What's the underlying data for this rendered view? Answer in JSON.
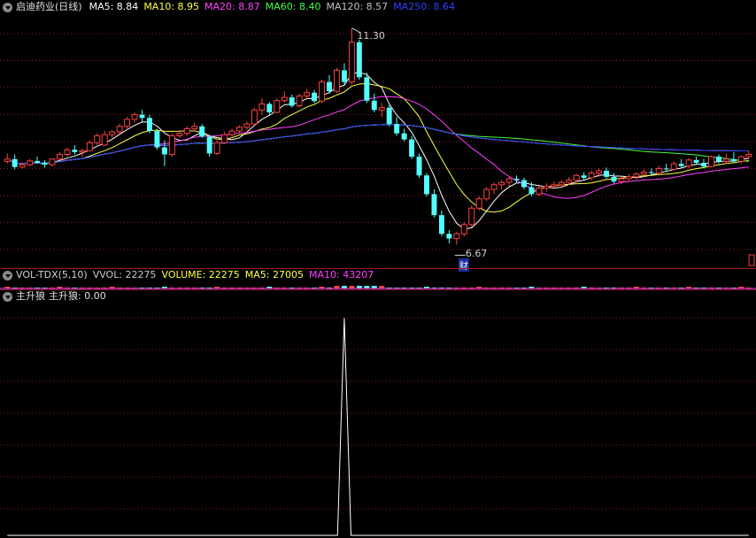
{
  "price_panel": {
    "stock_name": "启迪药业(日线)",
    "ma_legend": [
      {
        "text": "MA5: 8.84",
        "color": "#ffffff"
      },
      {
        "text": "MA10: 8.95",
        "color": "#ffff40"
      },
      {
        "text": "MA20: 8.87",
        "color": "#ff40ff"
      },
      {
        "text": "MA60: 8.40",
        "color": "#40ff40"
      },
      {
        "text": "MA120: 8.57",
        "color": "#c0c0c0"
      },
      {
        "text": "MA250: 8.64",
        "color": "#3040ff"
      }
    ],
    "high_label": "11.30",
    "low_label": "6.67",
    "event_marker": "财",
    "colors": {
      "up": "#ff4040",
      "down": "#54ffff",
      "grid": "#8b1e1e"
    }
  },
  "volume_panel": {
    "title": "VOL-TDX(5,10)",
    "items": [
      {
        "text": "VVOL: 22275",
        "color": "#c8c8c8"
      },
      {
        "text": "VOLUME: 22275",
        "color": "#ffff40"
      },
      {
        "text": "MA5: 27005",
        "color": "#ffff40"
      },
      {
        "text": "MA10: 43207",
        "color": "#ff40ff"
      }
    ]
  },
  "indicator_panel": {
    "title": "主升狼",
    "value_label": "主升狼: 0.00",
    "line_color": "#ffffff"
  },
  "chart_data": {
    "type": "candlestick",
    "candles_ohlc": [
      [
        8.45,
        8.62,
        8.4,
        8.5
      ],
      [
        8.5,
        8.6,
        8.28,
        8.33
      ],
      [
        8.33,
        8.42,
        8.3,
        8.38
      ],
      [
        8.38,
        8.5,
        8.35,
        8.46
      ],
      [
        8.46,
        8.55,
        8.4,
        8.42
      ],
      [
        8.42,
        8.48,
        8.32,
        8.38
      ],
      [
        8.38,
        8.52,
        8.35,
        8.5
      ],
      [
        8.5,
        8.65,
        8.48,
        8.6
      ],
      [
        8.6,
        8.75,
        8.55,
        8.7
      ],
      [
        8.7,
        8.8,
        8.6,
        8.65
      ],
      [
        8.65,
        8.72,
        8.55,
        8.68
      ],
      [
        8.68,
        8.9,
        8.66,
        8.85
      ],
      [
        8.85,
        9.05,
        8.8,
        9.0
      ],
      [
        8.8,
        9.1,
        8.78,
        9.02
      ],
      [
        9.02,
        9.12,
        8.95,
        9.08
      ],
      [
        9.08,
        9.25,
        9.04,
        9.2
      ],
      [
        9.2,
        9.4,
        9.15,
        9.35
      ],
      [
        9.35,
        9.5,
        9.28,
        9.45
      ],
      [
        9.45,
        9.55,
        9.3,
        9.38
      ],
      [
        9.38,
        9.45,
        9.05,
        9.1
      ],
      [
        9.1,
        9.15,
        8.7,
        8.75
      ],
      [
        8.75,
        8.9,
        8.35,
        8.6
      ],
      [
        8.6,
        9.05,
        8.55,
        9.0
      ],
      [
        9.0,
        9.12,
        8.95,
        9.05
      ],
      [
        9.05,
        9.2,
        9.0,
        9.15
      ],
      [
        9.15,
        9.28,
        9.1,
        9.2
      ],
      [
        9.2,
        9.25,
        8.95,
        8.98
      ],
      [
        8.98,
        9.02,
        8.55,
        8.62
      ],
      [
        8.62,
        8.9,
        8.58,
        8.85
      ],
      [
        8.85,
        9.08,
        8.82,
        9.02
      ],
      [
        9.02,
        9.15,
        8.98,
        9.1
      ],
      [
        9.1,
        9.22,
        9.06,
        9.18
      ],
      [
        9.18,
        9.3,
        9.12,
        9.25
      ],
      [
        9.25,
        9.6,
        9.22,
        9.55
      ],
      [
        9.55,
        9.8,
        9.45,
        9.68
      ],
      [
        9.68,
        9.72,
        9.45,
        9.5
      ],
      [
        9.5,
        9.8,
        9.48,
        9.75
      ],
      [
        9.75,
        9.95,
        9.7,
        9.82
      ],
      [
        9.82,
        9.88,
        9.6,
        9.64
      ],
      [
        9.64,
        9.9,
        9.6,
        9.85
      ],
      [
        9.85,
        10.0,
        9.78,
        9.92
      ],
      [
        9.92,
        9.98,
        9.7,
        9.74
      ],
      [
        9.74,
        10.2,
        9.7,
        10.15
      ],
      [
        10.15,
        10.3,
        9.9,
        9.95
      ],
      [
        9.95,
        10.45,
        9.92,
        10.4
      ],
      [
        10.4,
        10.55,
        10.1,
        10.15
      ],
      [
        10.15,
        11.3,
        10.1,
        11.0
      ],
      [
        11.0,
        11.05,
        10.2,
        10.25
      ],
      [
        10.25,
        10.35,
        9.7,
        9.75
      ],
      [
        9.75,
        9.9,
        9.5,
        9.55
      ],
      [
        9.55,
        9.7,
        9.4,
        9.6
      ],
      [
        9.6,
        9.65,
        9.2,
        9.25
      ],
      [
        9.25,
        9.4,
        9.0,
        9.05
      ],
      [
        9.05,
        9.15,
        8.88,
        8.92
      ],
      [
        8.92,
        9.0,
        8.5,
        8.55
      ],
      [
        8.55,
        8.62,
        8.1,
        8.15
      ],
      [
        8.15,
        8.2,
        7.7,
        7.75
      ],
      [
        7.75,
        7.85,
        7.25,
        7.3
      ],
      [
        7.3,
        7.4,
        6.85,
        6.9
      ],
      [
        6.9,
        6.98,
        6.7,
        6.8
      ],
      [
        6.8,
        6.95,
        6.67,
        6.9
      ],
      [
        6.9,
        7.15,
        6.85,
        7.1
      ],
      [
        7.1,
        7.5,
        7.05,
        7.45
      ],
      [
        7.45,
        7.7,
        7.4,
        7.65
      ],
      [
        7.65,
        7.9,
        7.6,
        7.85
      ],
      [
        7.85,
        8.0,
        7.75,
        7.95
      ],
      [
        7.95,
        8.05,
        7.85,
        8.0
      ],
      [
        8.0,
        8.12,
        7.92,
        8.08
      ],
      [
        8.08,
        8.15,
        7.98,
        8.05
      ],
      [
        8.05,
        8.1,
        7.85,
        7.9
      ],
      [
        7.9,
        8.0,
        7.7,
        7.75
      ],
      [
        7.75,
        7.92,
        7.7,
        7.88
      ],
      [
        7.88,
        7.98,
        7.8,
        7.92
      ],
      [
        7.92,
        8.02,
        7.85,
        7.95
      ],
      [
        7.95,
        8.05,
        7.88,
        8.0
      ],
      [
        8.0,
        8.12,
        7.95,
        8.05
      ],
      [
        8.05,
        8.18,
        8.0,
        8.15
      ],
      [
        8.15,
        8.22,
        8.05,
        8.1
      ],
      [
        8.1,
        8.25,
        8.05,
        8.2
      ],
      [
        8.2,
        8.3,
        8.12,
        8.25
      ],
      [
        8.25,
        8.32,
        8.08,
        8.12
      ],
      [
        8.12,
        8.2,
        7.98,
        8.02
      ],
      [
        8.02,
        8.12,
        7.96,
        8.08
      ],
      [
        8.08,
        8.18,
        8.02,
        8.12
      ],
      [
        8.12,
        8.22,
        8.06,
        8.18
      ],
      [
        8.18,
        8.28,
        8.12,
        8.22
      ],
      [
        8.22,
        8.3,
        8.14,
        8.2
      ],
      [
        8.2,
        8.35,
        8.15,
        8.3
      ],
      [
        8.3,
        8.4,
        8.22,
        8.28
      ],
      [
        8.28,
        8.45,
        8.25,
        8.4
      ],
      [
        8.4,
        8.5,
        8.3,
        8.35
      ],
      [
        8.35,
        8.52,
        8.3,
        8.48
      ],
      [
        8.48,
        8.55,
        8.38,
        8.42
      ],
      [
        8.42,
        8.5,
        8.3,
        8.34
      ],
      [
        8.34,
        8.58,
        8.32,
        8.55
      ],
      [
        8.55,
        8.6,
        8.4,
        8.45
      ],
      [
        8.45,
        8.62,
        8.4,
        8.5
      ],
      [
        8.5,
        8.65,
        8.42,
        8.45
      ],
      [
        8.45,
        8.58,
        8.4,
        8.55
      ],
      [
        8.55,
        8.68,
        8.5,
        8.6
      ]
    ],
    "ylim": [
      6.3,
      11.6
    ],
    "indicator_spike": {
      "bar_index": 45,
      "value": 1.0
    },
    "ind_ylim": [
      0,
      1.05
    ]
  }
}
